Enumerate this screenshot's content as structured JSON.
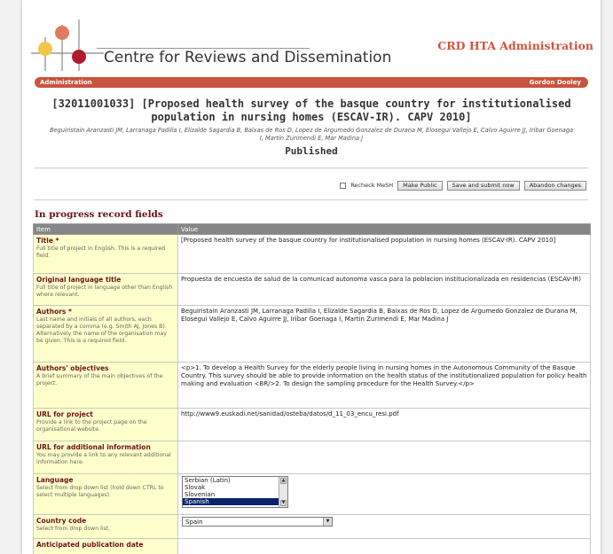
{
  "header": {
    "logo_text": "Centre for Reviews and Dissemination",
    "app_title": "CRD HTA Administration"
  },
  "adminbar": {
    "left_label": "Administration",
    "user_name": "Gordon Dooley"
  },
  "record": {
    "title": "[32011001033] [Proposed health survey of the basque country for institutionalised population in nursing homes (ESCAV-IR). CAPV 2010]",
    "authors": "Beguiristain Aranzasti JM, Larranaga Padilla I, Elizalde Sagardia B, Baixas de Ros D, Lopez de Argumedo Gonzalez de Durana M, Elosegui Vallejo E, Calvo Aguirre JJ, Iribar Goenaga I, Martin Zurimendi E, Mar Madina J",
    "status": "Published"
  },
  "actions": {
    "recheck_label": "Recheck MeSH",
    "make_public": "Make Public",
    "save_submit": "Save and submit now",
    "abandon": "Abandon changes"
  },
  "section_title": "In progress record fields",
  "table": {
    "col_item": "Item",
    "col_value": "Value",
    "rows": [
      {
        "name": "Title *",
        "desc": "Full title of project in English. This is a required field.",
        "value": "[Proposed health survey of the basque country for institutionalised population in nursing homes (ESCAV-IR). CAPV 2010]"
      },
      {
        "name": "Original language title",
        "desc": "Full title of project in language other than English where relevant.",
        "value": "Propuesta de encuesta de salud de la comunicad autonoma vasca para la poblacion institucionalizada en residencias (ESCAV-IR)"
      },
      {
        "name": "Authors *",
        "desc": "Last name and initials of all authors, each separated by a comma (e.g. Smith AJ, Jones B). Alternatively the name of the organisation may be given. This is a required field.",
        "value": "Beguiristain Aranzasti JM, Larranaga Padilla I, Elizalde Sagardia B, Baixas de Ros D, Lopez de Argumedo Gonzalez de Durana M, Elosegui Vallejo E, Calvo Aguirre JJ, Iribar Goenaga I, Martin Zurimendi E, Mar Madina J"
      },
      {
        "name": "Authors' objectives",
        "desc": "A brief summary of the main objectives of the project.",
        "value": "<p>1. To develop a Health Survey for the elderly people living in nursing homes in the Autonomous Community of the Basque Country. This survey should be able to provide information on the health status of the institutionalized population for policy health making and evaluation <BR/>2. To design the sampling procedure for the Health Survey.</p>"
      },
      {
        "name": "URL for project",
        "desc": "Provide a link to the project page on the organisational website.",
        "value": "http://www9.euskadi.net/sanidad/osteba/datos/d_11_03_encu_resi.pdf"
      },
      {
        "name": "URL for additional information",
        "desc": "You may provide a link to any relevant additional information here.",
        "value": ""
      },
      {
        "name": "Language",
        "desc": "Select from drop down list (hold down CTRL to select multiple languages).",
        "options": [
          "Serbian (Latin)",
          "Slovak",
          "Slovenian",
          "Spanish"
        ],
        "selected": "Spanish"
      },
      {
        "name": "Country code",
        "desc": "Select from drop down list.",
        "selected": "Spain"
      },
      {
        "name": "Anticipated publication date",
        "desc": "",
        "value": ""
      }
    ]
  }
}
